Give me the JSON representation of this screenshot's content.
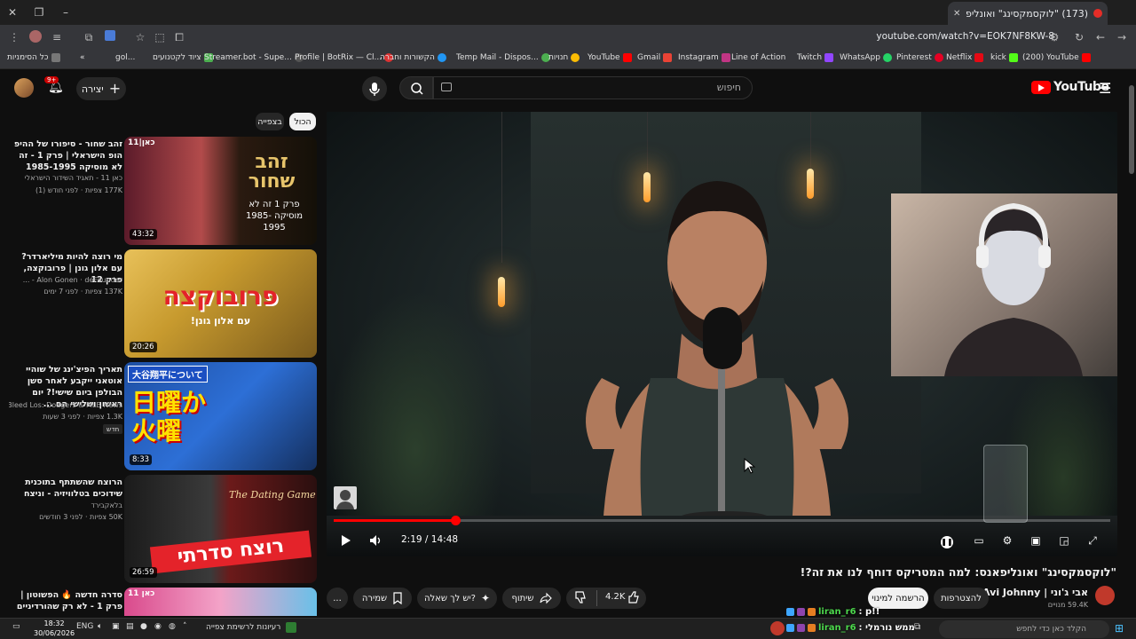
{
  "browser": {
    "tab_title": "(173) \"לוקסמקסינג\" ואונליפ...",
    "url": "youtube.com/watch?v=EOK7NF8KW-8",
    "all_bookmarks_label": "כל הסימניות",
    "bookmarks": [
      "gol...",
      "ציוד לקטנועים",
      "Streamer.bot - Supe...",
      "Profile | BotRix — Cl...",
      "הקשורות וחברה",
      "Temp Mail - Dispos...",
      "חנויות",
      "YouTube",
      "Gmail",
      "Instagram",
      "Line of Action",
      "Twitch",
      "WhatsApp",
      "Pinterest",
      "Netflix",
      "kick",
      "(200) YouTube"
    ]
  },
  "yt": {
    "logo": "YouTube",
    "create_label": "יצירה",
    "notif_count": "9+",
    "search_placeholder": "חיפוש",
    "chips": [
      "הכול",
      "בצפייה"
    ]
  },
  "player": {
    "current_time": "2:19",
    "duration": "14:48",
    "time_text": "2:19 / 14:48",
    "progress_fraction": 0.157
  },
  "video": {
    "title": "\"לוקסמקסינג\" ואונליפאנס: למה המטריקס דוחף לנו את זה?!",
    "channel": "אבי ג'וני | Avi Johnny",
    "subscribers": "59.4K מנויים",
    "join_label": "להצטרפות",
    "subscribe_label": "הרשמה למינוי",
    "likes": "4.2K",
    "share_label": "שיתוף",
    "ask_label": "יש לך שאלה?",
    "save_label": "שמירה",
    "more_label": "..."
  },
  "sidebar": [
    {
      "title": "זהב שחור - סיפורו של ההיפ הופ הישראלי | פרק 1 - זה לא מוסיקה 1985-1995",
      "channel": "כאן 11 - תאגיד השידור הישראלי",
      "meta": "177K צפיות · לפני חודש (1)",
      "duration": "43:32",
      "thumb_text": "זהב שחור",
      "thumb_sub": "פרק 1 זה לא מוסיקה 1985-1995"
    },
    {
      "title": "מי רוצה להיות מיליארדר? עם אלון גונן | פרובוקצה, פרק 12",
      "channel": "Alon Gonen · deFounder - ...",
      "meta": "137K צפיות · לפני 7 ימים",
      "duration": "20:26",
      "thumb_text": "פרובוקצה",
      "thumb_sub": "עם אלון גונן!"
    },
    {
      "title": "תאריך הפיצ'ינג של שוהיי אוטאני ייקבע לאחר סשן הבולפן ביום שישי!? יום ראשון ושלישי הם ...",
      "channel": "Bleed Los: Dodgers & MLB News ...",
      "meta": "1.3K צפיות · לפני 3 שעות",
      "badge": "חדש",
      "duration": "8:33",
      "thumb_text": "日曜か火曜",
      "thumb_sub": "大谷翔平について"
    },
    {
      "title": "הרוצח שהשתתף בתוכנית שידוכים בטלוויזיה - וניצח",
      "channel": "בלאקבירד",
      "meta": "50K צפיות · לפני 3 חודשים",
      "duration": "26:59",
      "thumb_text": "רוצח סדרתי",
      "thumb_sub": "The Dating Game"
    },
    {
      "title": "סדרה חדשה 🔥 הפשוטון | פרק 1 - לא רק שהורדיניים",
      "channel": "כאן 11",
      "meta": "",
      "duration": "",
      "thumb_text": "כאן 11",
      "thumb_sub": ""
    }
  ],
  "chat": [
    {
      "user": "liran_r6",
      "text": ": p!!"
    },
    {
      "user": "liran_r6",
      "text": ": ממש נורמלי"
    }
  ],
  "taskbar": {
    "time": "18:32",
    "date": "30/06/2026",
    "lang": "ENG",
    "news": "רעיונות לרשימת צפייה",
    "search_placeholder": "הקלד כאן כדי לחפש"
  },
  "colors": {
    "accent_red": "#ff0000",
    "bg": "#0f0f0f",
    "pill": "#272727"
  }
}
